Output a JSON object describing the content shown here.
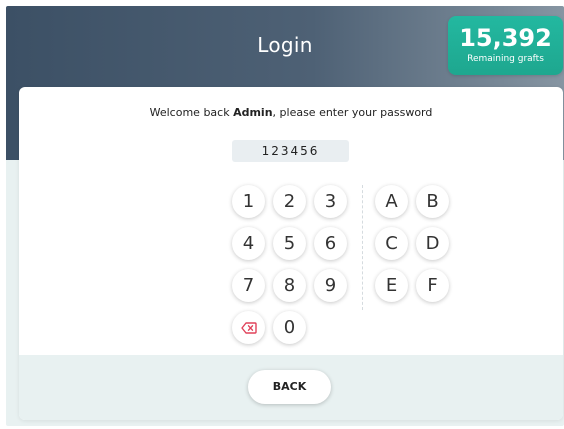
{
  "header": {
    "title": "Login"
  },
  "badge": {
    "value": "15,392",
    "label": "Remaining grafts"
  },
  "welcome": {
    "prefix": "Welcome back ",
    "user": "Admin",
    "suffix": ", please enter your password"
  },
  "password": {
    "value": "123456"
  },
  "keypad": {
    "k1": "1",
    "k2": "2",
    "k3": "3",
    "k4": "4",
    "k5": "5",
    "k6": "6",
    "k7": "7",
    "k8": "8",
    "k9": "9",
    "k0": "0",
    "kA": "A",
    "kB": "B",
    "kC": "C",
    "kD": "D",
    "kE": "E",
    "kF": "F",
    "delete_icon": "backspace-icon",
    "delete_color": "#e0425a"
  },
  "footer": {
    "back_label": "BACK"
  }
}
